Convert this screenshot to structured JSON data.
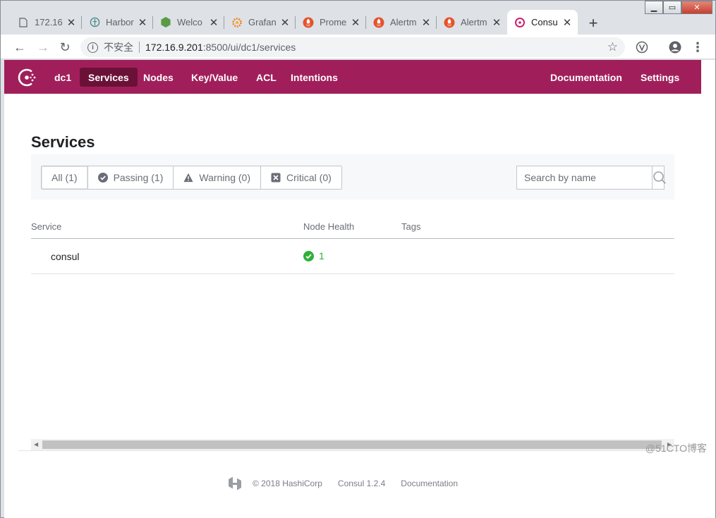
{
  "browser": {
    "tabs": [
      {
        "title": "172.16",
        "icon": "page-icon"
      },
      {
        "title": "Harbor",
        "icon": "harbor-icon"
      },
      {
        "title": "Welco",
        "icon": "node-icon"
      },
      {
        "title": "Grafan",
        "icon": "grafana-icon"
      },
      {
        "title": "Prome",
        "icon": "prometheus-icon"
      },
      {
        "title": "Alertm",
        "icon": "prometheus-icon"
      },
      {
        "title": "Alertm",
        "icon": "prometheus-icon"
      },
      {
        "title": "Consu",
        "icon": "consul-icon",
        "active": true
      }
    ],
    "address": {
      "security_label": "不安全",
      "host": "172.16.9.201",
      "path": ":8500/ui/dc1/services"
    }
  },
  "consul": {
    "brand_color": "#a01f5a",
    "datacenter": "dc1",
    "nav": {
      "services": "Services",
      "nodes": "Nodes",
      "kv": "Key/Value",
      "acl": "ACL",
      "intentions": "Intentions",
      "documentation": "Documentation",
      "settings": "Settings"
    },
    "page_title": "Services",
    "filters": {
      "all": "All (1)",
      "passing": "Passing (1)",
      "warning": "Warning (0)",
      "critical": "Critical (0)"
    },
    "search_placeholder": "Search by name",
    "table": {
      "headers": {
        "service": "Service",
        "health": "Node Health",
        "tags": "Tags"
      },
      "rows": [
        {
          "service": "consul",
          "passing": "1"
        }
      ]
    },
    "footer": {
      "copyright": "© 2018 HashiCorp",
      "version": "Consul 1.2.4",
      "docs": "Documentation"
    }
  },
  "watermark": "@51CTO博客"
}
